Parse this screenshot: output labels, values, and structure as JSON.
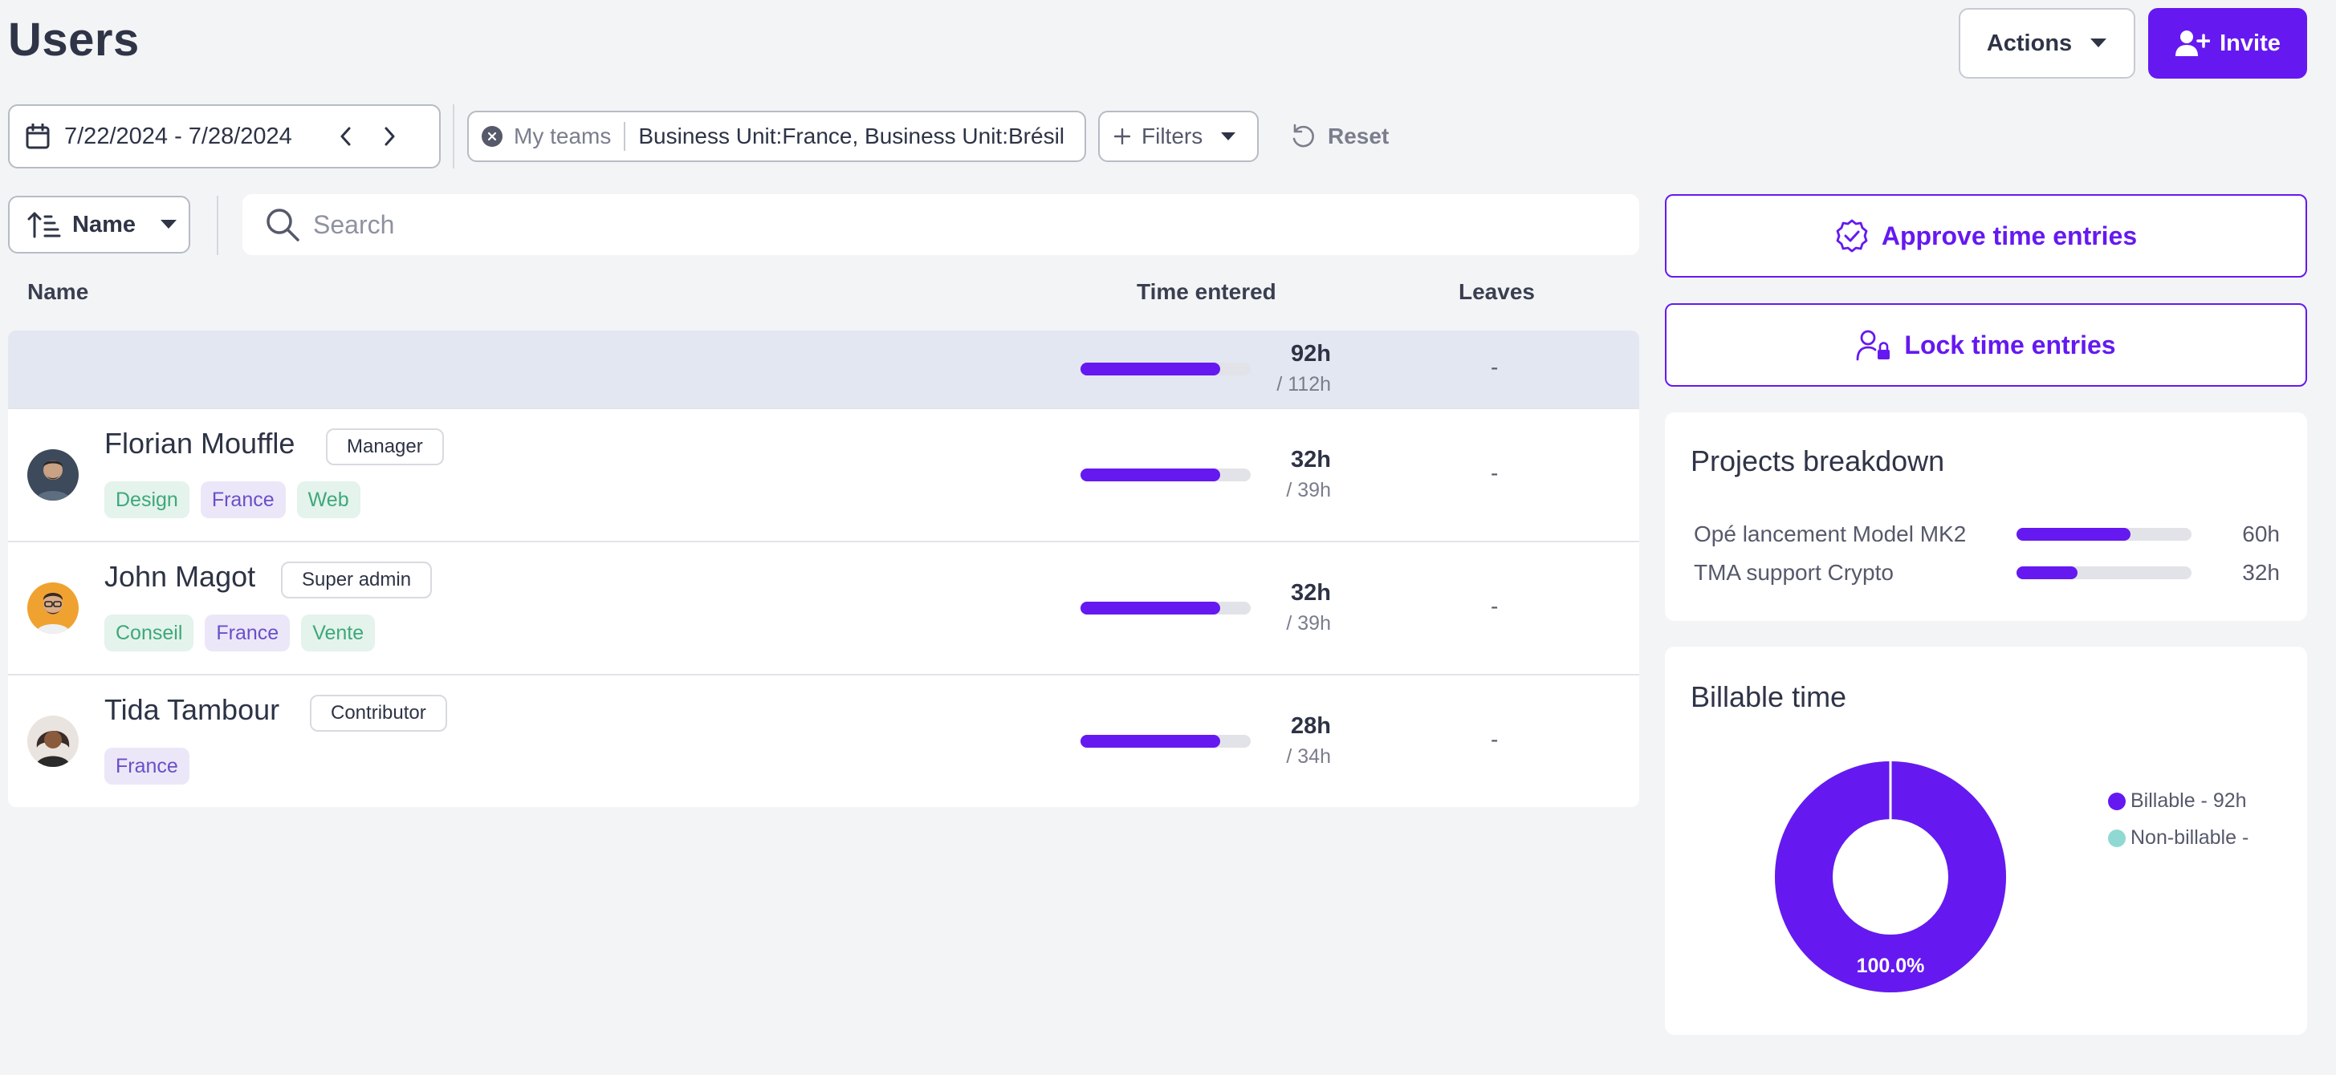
{
  "page": {
    "title": "Users",
    "actions_label": "Actions",
    "invite_label": "Invite"
  },
  "filters": {
    "date_range": "7/22/2024 - 7/28/2024",
    "team_label": "My teams",
    "team_value": "Business Unit:France, Business Unit:Brésil",
    "filters_label": "Filters",
    "reset_label": "Reset"
  },
  "toolbar": {
    "sort_label": "Name",
    "search_placeholder": "Search"
  },
  "table": {
    "headers": {
      "name": "Name",
      "time": "Time entered",
      "leaves": "Leaves"
    },
    "total": {
      "entered": "92h",
      "expected": "/ 112h",
      "progress": 0.82,
      "leaves": "-"
    },
    "users": [
      {
        "name": "Florian Mouffle",
        "role": "Manager",
        "tags": [
          {
            "label": "Design",
            "color": "green"
          },
          {
            "label": "France",
            "color": "purple"
          },
          {
            "label": "Web",
            "color": "green"
          }
        ],
        "entered": "32h",
        "expected": "/ 39h",
        "progress": 0.82,
        "leaves": "-",
        "avatar_color": "#3d4a5c"
      },
      {
        "name": "John Magot",
        "role": "Super admin",
        "tags": [
          {
            "label": "Conseil",
            "color": "green"
          },
          {
            "label": "France",
            "color": "purple"
          },
          {
            "label": "Vente",
            "color": "green"
          }
        ],
        "entered": "32h",
        "expected": "/ 39h",
        "progress": 0.82,
        "leaves": "-",
        "avatar_color": "#f0a230"
      },
      {
        "name": "Tida Tambour",
        "role": "Contributor",
        "tags": [
          {
            "label": "France",
            "color": "purple"
          }
        ],
        "entered": "28h",
        "expected": "/ 34h",
        "progress": 0.82,
        "leaves": "-",
        "avatar_color": "#3a2c28"
      }
    ]
  },
  "side": {
    "approve_label": "Approve time entries",
    "lock_label": "Lock time entries",
    "projects": {
      "title": "Projects breakdown",
      "items": [
        {
          "name": "Opé lancement Model MK2",
          "value": "60h",
          "progress": 0.65
        },
        {
          "name": "TMA support Crypto",
          "value": "32h",
          "progress": 0.35
        }
      ]
    },
    "billable": {
      "title": "Billable time",
      "legend": [
        {
          "label": "Billable - 92h",
          "color": "#6519f0"
        },
        {
          "label": "Non-billable -",
          "color": "#8fd9d2"
        }
      ],
      "percent_label": "100.0%",
      "billable_fraction": 1.0
    }
  },
  "colors": {
    "accent": "#6519f0",
    "background": "#f3f4f6"
  }
}
